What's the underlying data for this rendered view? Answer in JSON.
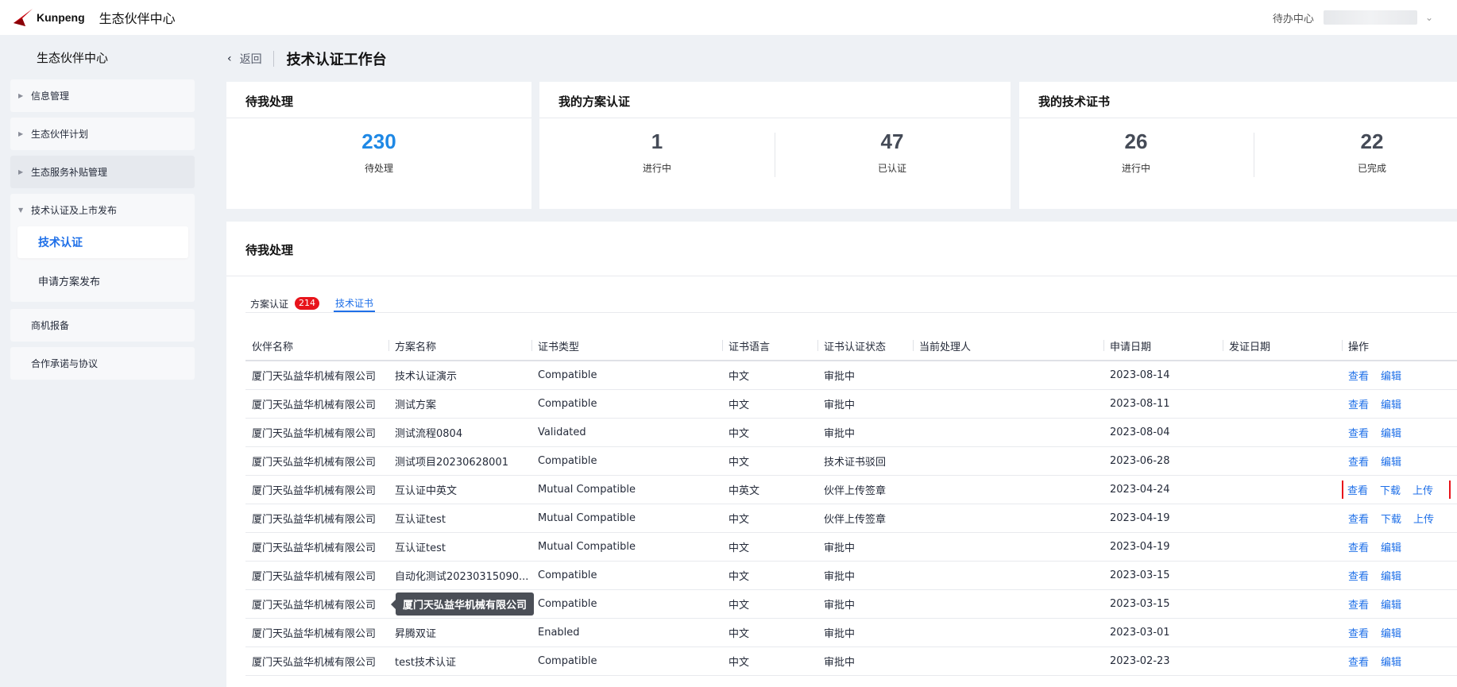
{
  "header": {
    "logo_text": "Kunpeng",
    "app_title": "生态伙伴中心",
    "todo_center": "待办中心",
    "chevron": "chevron-down-icon"
  },
  "sidebar": {
    "title": "生态伙伴中心",
    "items": [
      {
        "label": "信息管理"
      },
      {
        "label": "生态伙伴计划"
      },
      {
        "label": "生态服务补贴管理"
      },
      {
        "label": "技术认证及上市发布"
      },
      {
        "label": "技术认证"
      },
      {
        "label": "申请方案发布"
      },
      {
        "label": "商机报备"
      },
      {
        "label": "合作承诺与协议"
      }
    ]
  },
  "page": {
    "back": "返回",
    "title": "技术认证工作台"
  },
  "cards": {
    "pending": {
      "title": "待我处理",
      "value": "230",
      "label": "待处理"
    },
    "solution": {
      "title": "我的方案认证",
      "in_progress_value": "1",
      "in_progress_label": "进行中",
      "certified_value": "47",
      "certified_label": "已认证"
    },
    "tech": {
      "title": "我的技术证书",
      "in_progress_value": "26",
      "in_progress_label": "进行中",
      "done_value": "22",
      "done_label": "已完成"
    }
  },
  "panel": {
    "title": "待我处理",
    "tabs": [
      {
        "label": "方案认证",
        "badge": "214"
      },
      {
        "label": "技术证书"
      }
    ],
    "columns": [
      "伙伴名称",
      "方案名称",
      "证书类型",
      "证书语言",
      "证书认证状态",
      "当前处理人",
      "申请日期",
      "发证日期",
      "操作"
    ],
    "rows": [
      {
        "partner": "厦门天弘益华机械有限公司",
        "solution": "技术认证演示",
        "type": "Compatible",
        "lang": "中文",
        "status": "审批中",
        "handler": "",
        "apply": "2023-08-14",
        "issue": "",
        "ops": [
          "查看",
          "编辑"
        ]
      },
      {
        "partner": "厦门天弘益华机械有限公司",
        "solution": "测试方案",
        "type": "Compatible",
        "lang": "中文",
        "status": "审批中",
        "handler": "",
        "apply": "2023-08-11",
        "issue": "",
        "ops": [
          "查看",
          "编辑"
        ]
      },
      {
        "partner": "厦门天弘益华机械有限公司",
        "solution": "测试流程0804",
        "type": "Validated",
        "lang": "中文",
        "status": "审批中",
        "handler": "",
        "apply": "2023-08-04",
        "issue": "",
        "ops": [
          "查看",
          "编辑"
        ]
      },
      {
        "partner": "厦门天弘益华机械有限公司",
        "solution": "测试项目20230628001",
        "type": "Compatible",
        "lang": "中文",
        "status": "技术证书驳回",
        "handler": "",
        "apply": "2023-06-28",
        "issue": "",
        "ops": [
          "查看",
          "编辑"
        ]
      },
      {
        "partner": "厦门天弘益华机械有限公司",
        "solution": "互认证中英文",
        "type": "Mutual Compatible",
        "lang": "中英文",
        "status": "伙伴上传签章",
        "handler": "",
        "apply": "2023-04-24",
        "issue": "",
        "ops": [
          "查看",
          "下载",
          "上传"
        ]
      },
      {
        "partner": "厦门天弘益华机械有限公司",
        "solution": "互认证test",
        "type": "Mutual Compatible",
        "lang": "中文",
        "status": "伙伴上传签章",
        "handler": "",
        "apply": "2023-04-19",
        "issue": "",
        "ops": [
          "查看",
          "下载",
          "上传"
        ]
      },
      {
        "partner": "厦门天弘益华机械有限公司",
        "solution": "互认证test",
        "type": "Mutual Compatible",
        "lang": "中文",
        "status": "审批中",
        "handler": "",
        "apply": "2023-04-19",
        "issue": "",
        "ops": [
          "查看",
          "编辑"
        ]
      },
      {
        "partner": "厦门天弘益华机械有限公司",
        "solution": "自动化测试20230315090...",
        "type": "Compatible",
        "lang": "中文",
        "status": "审批中",
        "handler": "",
        "apply": "2023-03-15",
        "issue": "",
        "ops": [
          "查看",
          "编辑"
        ]
      },
      {
        "partner": "厦门天弘益华机械有限公司",
        "solution": "",
        "type": "Compatible",
        "lang": "中文",
        "status": "审批中",
        "handler": "",
        "apply": "2023-03-15",
        "issue": "",
        "ops": [
          "查看",
          "编辑"
        ]
      },
      {
        "partner": "厦门天弘益华机械有限公司",
        "solution": "昇腾双证",
        "type": "Enabled",
        "lang": "中文",
        "status": "审批中",
        "handler": "",
        "apply": "2023-03-01",
        "issue": "",
        "ops": [
          "查看",
          "编辑"
        ]
      },
      {
        "partner": "厦门天弘益华机械有限公司",
        "solution": "test技术认证",
        "type": "Compatible",
        "lang": "中文",
        "status": "审批中",
        "handler": "",
        "apply": "2023-02-23",
        "issue": "",
        "ops": [
          "查看",
          "编辑"
        ]
      }
    ],
    "tooltip": "厦门天弘益华机械有限公司"
  }
}
